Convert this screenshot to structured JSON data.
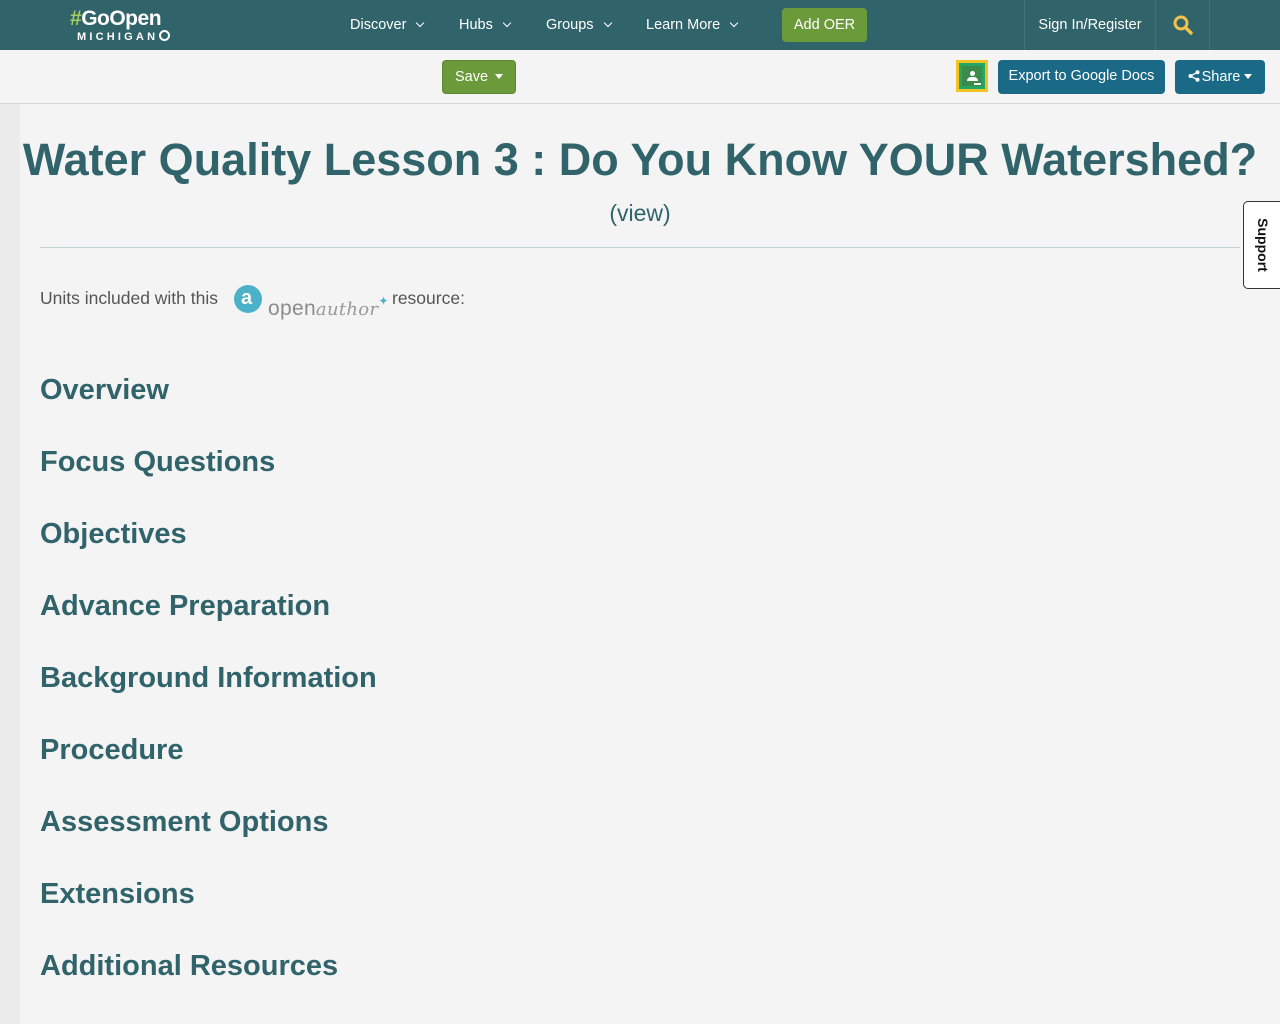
{
  "topnav": {
    "logo_hash": "#",
    "logo_top": "GoOpen",
    "logo_bottom": "MICHIGAN",
    "items": [
      {
        "label": "Discover"
      },
      {
        "label": "Hubs"
      },
      {
        "label": "Groups"
      },
      {
        "label": "Learn More"
      }
    ],
    "add_oer": "Add OER",
    "sign_in": "Sign In/Register",
    "search_icon": "search-icon"
  },
  "toolbar": {
    "save": "Save",
    "classroom_icon": "google-classroom-icon",
    "export": "Export to Google Docs",
    "share": "Share"
  },
  "page": {
    "title": "Water Quality Lesson 3 : Do You Know YOUR Watershed?",
    "view_link": "(view)",
    "units_prefix": "Units included with this",
    "units_suffix": "resource:",
    "openauthor_logo": {
      "open": "open",
      "author": "author"
    }
  },
  "sections": [
    "Overview",
    "Focus Questions",
    "Objectives",
    "Advance Preparation",
    "Background Information",
    "Procedure",
    "Assessment Options",
    "Extensions",
    "Additional Resources"
  ],
  "support_tab": "Support",
  "colors": {
    "nav_bg": "#30636a",
    "accent_green": "#6b9a3a",
    "button_blue": "#1a6a87",
    "heading": "#30636a",
    "search_icon": "#f0c24b"
  }
}
